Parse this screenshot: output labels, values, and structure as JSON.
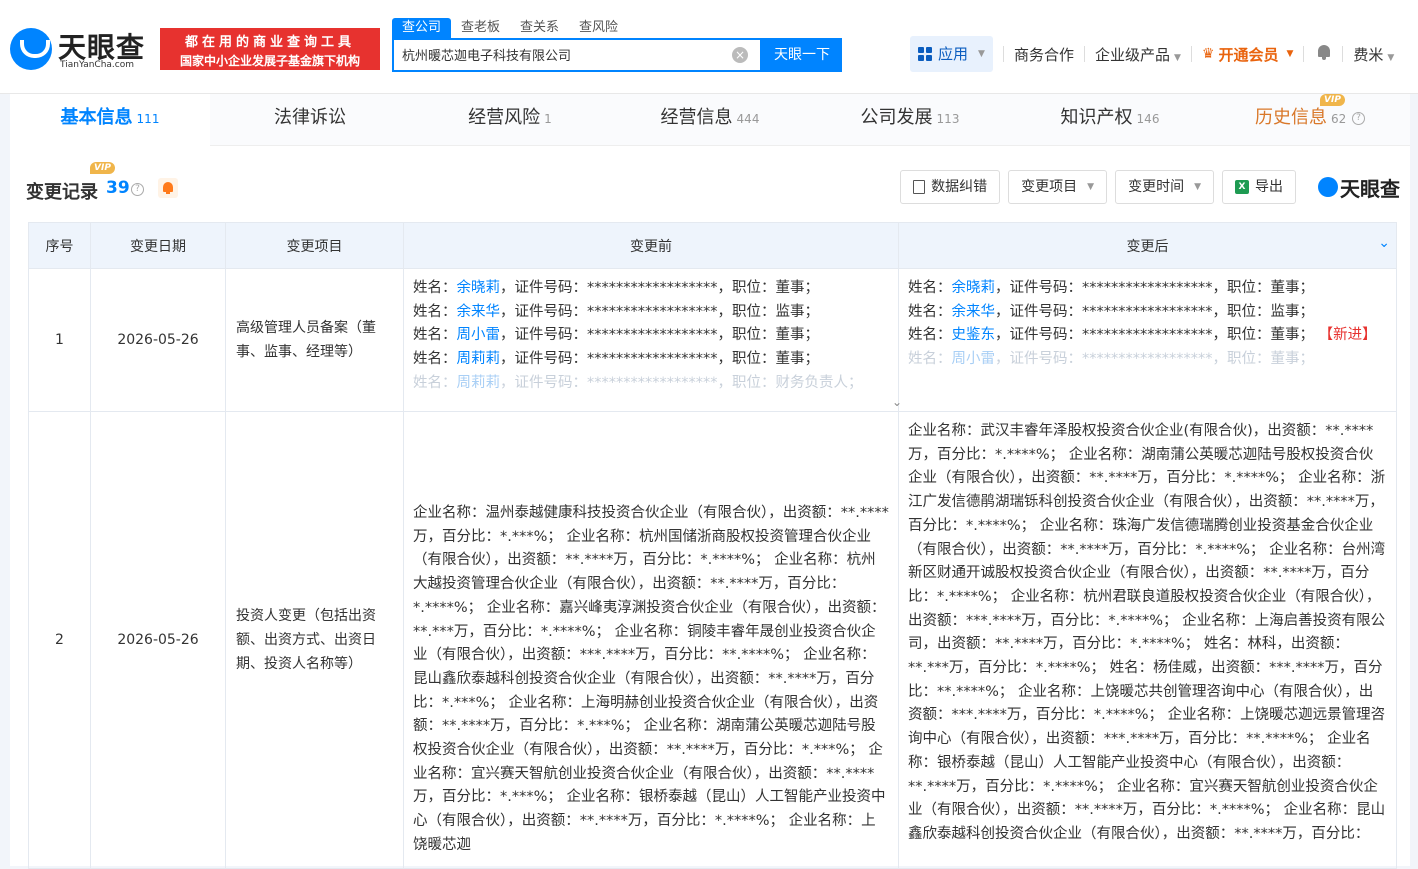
{
  "header": {
    "logo_text": "天眼查",
    "logo_sub": "TianYanCha.com",
    "promo_line1": "都在用的商业查询工具",
    "promo_line2": "国家中小企业发展子基金旗下机构",
    "search_tabs": [
      "查公司",
      "查老板",
      "查关系",
      "查风险"
    ],
    "search_value": "杭州暖芯迦电子科技有限公司",
    "search_button": "天眼一下",
    "nav": {
      "apps": "应用",
      "business": "商务合作",
      "enterprise": "企业级产品",
      "vip": "开通会员",
      "user": "费米"
    }
  },
  "tabs": [
    {
      "label": "基本信息",
      "count": "111"
    },
    {
      "label": "法律诉讼",
      "count": ""
    },
    {
      "label": "经营风险",
      "count": "1"
    },
    {
      "label": "经营信息",
      "count": "444"
    },
    {
      "label": "公司发展",
      "count": "113"
    },
    {
      "label": "知识产权",
      "count": "146"
    },
    {
      "label": "历史信息",
      "count": "62"
    }
  ],
  "vip_badge": "VIP",
  "section": {
    "title": "变更记录",
    "count": "39",
    "tools": {
      "correct": "数据纠错",
      "item_filter": "变更项目",
      "time_filter": "变更时间",
      "export": "导出",
      "brand": "天眼查"
    }
  },
  "table": {
    "headers": {
      "no": "序号",
      "date": "变更日期",
      "item": "变更项目",
      "before": "变更前",
      "after": "变更后"
    },
    "rows": [
      {
        "no": "1",
        "date": "2026-05-26",
        "item": "高级管理人员备案（董事、监事、经理等）",
        "before": [
          {
            "l": "姓名：",
            "n": "余晓莉",
            "r": "，证件号码：******************，职位：董事；"
          },
          {
            "l": "姓名：",
            "n": "余来华",
            "r": "，证件号码：******************，职位：监事；"
          },
          {
            "l": "姓名：",
            "n": "周小雷",
            "r": "，证件号码：******************，职位：董事；"
          },
          {
            "l": "姓名：",
            "n": "周莉莉",
            "r": "，证件号码：******************，职位：董事；"
          },
          {
            "l": "姓名：",
            "n": "周莉莉",
            "r": "，证件号码：******************，职位：财务负责人；"
          }
        ],
        "after": [
          {
            "l": "姓名：",
            "n": "余晓莉",
            "r": "，证件号码：******************，职位：董事；"
          },
          {
            "l": "姓名：",
            "n": "余来华",
            "r": "，证件号码：******************，职位：监事；"
          },
          {
            "l": "姓名：",
            "n": "史鉴东",
            "r": "，证件号码：******************，职位：董事；"
          },
          {
            "l": "姓名：",
            "n": "周小雷",
            "r": "，证件号码：******************，职位：董事；"
          }
        ],
        "new_tag": "【新进】"
      },
      {
        "no": "2",
        "date": "2026-05-26",
        "item": "投资人变更（包括出资额、出资方式、出资日期、投资人名称等）",
        "before_text": "企业名称：温州泰越健康科技投资合伙企业（有限合伙），出资额：**.****万，百分比：*.***%； 企业名称：杭州国储浙商股权投资管理合伙企业（有限合伙），出资额：**.****万，百分比：*.****%； 企业名称：杭州大越投资管理合伙企业（有限合伙），出资额：**.****万，百分比：*.****%； 企业名称：嘉兴峰夷淳渊投资合伙企业（有限合伙），出资额：**.***万，百分比：*.****%； 企业名称：铜陵丰睿年晟创业投资合伙企业（有限合伙），出资额：***.****万，百分比：**.****%； 企业名称：昆山鑫欣泰越科创投资合伙企业（有限合伙），出资额：**.****万，百分比：*.***%； 企业名称：上海明赫创业投资合伙企业（有限合伙），出资额：**.****万，百分比：*.***%； 企业名称：湖南蒲公英暖芯迦陆号股权投资合伙企业（有限合伙），出资额：**.****万，百分比：*.***%； 企业名称：宜兴赛天智航创业投资合伙企业（有限合伙），出资额：**.****万，百分比：*.***%； 企业名称：银桥泰越（昆山）人工智能产业投资中心（有限合伙），出资额：**.****万，百分比：*.****%； 企业名称：上饶暖芯迦",
        "after_text": "企业名称：武汉丰睿年泽股权投资合伙企业(有限合伙)，出资额：**.****万，百分比：*.****%； 企业名称：湖南蒲公英暖芯迦陆号股权投资合伙企业（有限合伙），出资额：**.****万，百分比：*.****%； 企业名称：浙江广发信德鹃湖瑞铄科创投资合伙企业（有限合伙），出资额：**.****万，百分比：*.****%； 企业名称：珠海广发信德瑞腾创业投资基金合伙企业（有限合伙），出资额：**.****万，百分比：*.****%； 企业名称：台州湾新区财通开诚股权投资合伙企业（有限合伙），出资额：**.****万，百分比：*.****%； 企业名称：杭州君联良道股权投资合伙企业（有限合伙），出资额：***.****万，百分比：*.****%； 企业名称：上海启善投资有限公司，出资额：**.****万，百分比：*.****%； 姓名：林科，出资额：**.***万，百分比：*.****%； 姓名：杨佳威，出资额：***.****万，百分比：**.****%； 企业名称：上饶暖芯共创管理咨询中心（有限合伙），出资额：***.****万，百分比：*.****%； 企业名称：上饶暖芯迦远景管理咨询中心（有限合伙），出资额：***.****万，百分比：**.****%； 企业名称：银桥泰越（昆山）人工智能产业投资中心（有限合伙），出资额：**.****万，百分比：*.****%； 企业名称：宜兴赛天智航创业投资合伙企业（有限合伙），出资额：**.****万，百分比：*.****%； 企业名称：昆山鑫欣泰越科创投资合伙企业（有限合伙），出资额：**.****万，百分比："
      }
    ]
  }
}
